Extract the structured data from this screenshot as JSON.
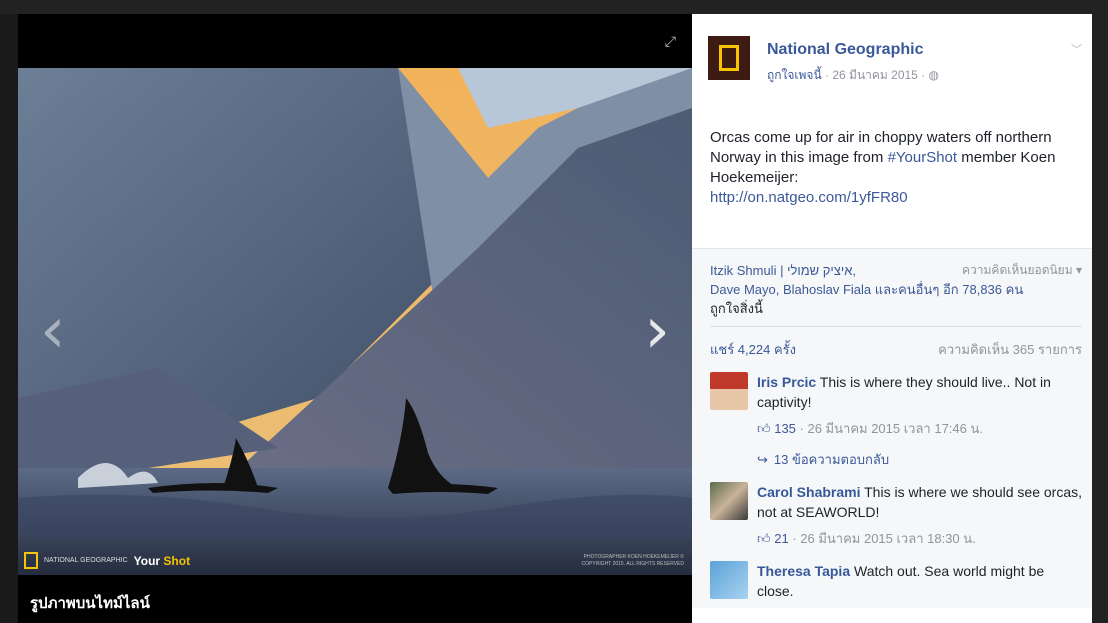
{
  "caption": "รูปภาพบนไทม์ไลน์",
  "photo": {
    "watermark_brand_small": "NATIONAL GEOGRAPHIC",
    "watermark_your": "Your",
    "watermark_shot": "Shot",
    "copyright": "PHOTOGRAPHER KOEN HOEKEMEIJER © COPYRIGHT 2015. ALL RIGHTS RESERVED"
  },
  "post": {
    "page_name": "National Geographic",
    "liked_label": "ถูกใจเพจนี้",
    "date": "· 26 มีนาคม 2015 ·",
    "text_main": "Orcas come up for air in choppy waters off northern Norway in this image from",
    "hashtag": "#YourShot",
    "text_after_hashtag": " member Koen Hoekemeijer:",
    "link": "http://on.natgeo.com/1yfFR80"
  },
  "likes": {
    "names_first": "Itzik Shmuli | איציק שמולי,",
    "top_comments_label": "ความคิดเห็นยอดนิยม",
    "names_rest": "Dave Mayo, Blahoslav Fiala",
    "others_count": "และคนอื่นๆ อีก 78,836 คน",
    "like_this": "ถูกใจสิ่งนี้"
  },
  "counts": {
    "shares": "แชร์ 4,224 ครั้ง",
    "comments": "ความคิดเห็น 365 รายการ"
  },
  "comments": [
    {
      "author": "Iris Prcic",
      "text": " This is where they should live.. Not in captivity!",
      "likes": "135",
      "time": "· 26 มีนาคม 2015 เวลา 17:46 น.",
      "replies": "13 ข้อความตอบกลับ"
    },
    {
      "author": "Carol Shabrami",
      "text": " This is where we should see orcas, not at SEAWORLD!",
      "likes": "21",
      "time": "· 26 มีนาคม 2015 เวลา 18:30 น."
    },
    {
      "author": "Theresa Tapia",
      "text": " Watch out. Sea world might be close."
    }
  ],
  "icons": {
    "expand": "expand-icon",
    "prev": "chevron-left-icon",
    "next": "chevron-right-icon",
    "globe": "globe-icon",
    "like": "thumbs-up-icon",
    "reply": "reply-arrow-icon"
  },
  "colors": {
    "link_blue": "#3b5998",
    "natgeo_yellow": "#f6c400"
  }
}
